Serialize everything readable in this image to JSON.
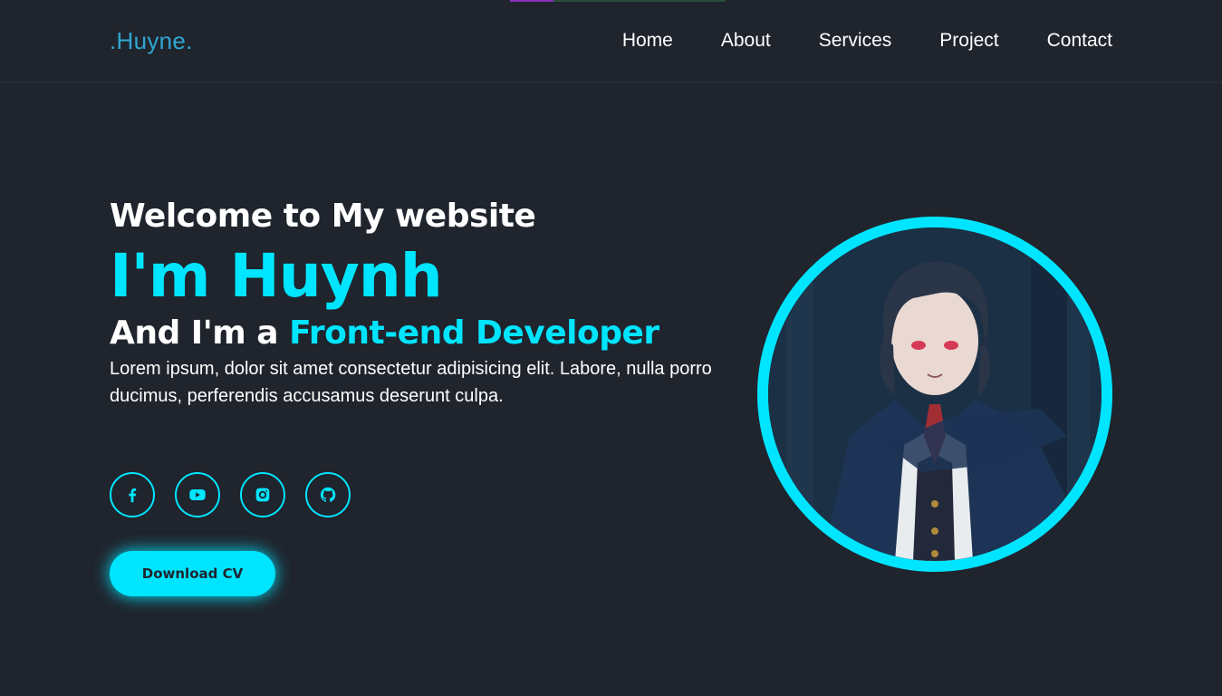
{
  "header": {
    "logo": ".Huyne.",
    "nav": [
      "Home",
      "About",
      "Services",
      "Project",
      "Contact"
    ]
  },
  "hero": {
    "welcome": "Welcome to My website",
    "name": "I'm Huynh",
    "role_prefix": "And I'm a ",
    "role_highlight": "Front-end Developer",
    "description": "Lorem ipsum, dolor sit amet consectetur adipisicing elit. Labore, nulla porro ducimus, perferendis accusamus deserunt culpa.",
    "socials": [
      "facebook-icon",
      "youtube-icon",
      "instagram-icon",
      "github-icon"
    ],
    "cta": "Download CV"
  },
  "colors": {
    "background": "#1f242d",
    "accent": "#00e5ff",
    "logo": "#2fa7d1"
  }
}
